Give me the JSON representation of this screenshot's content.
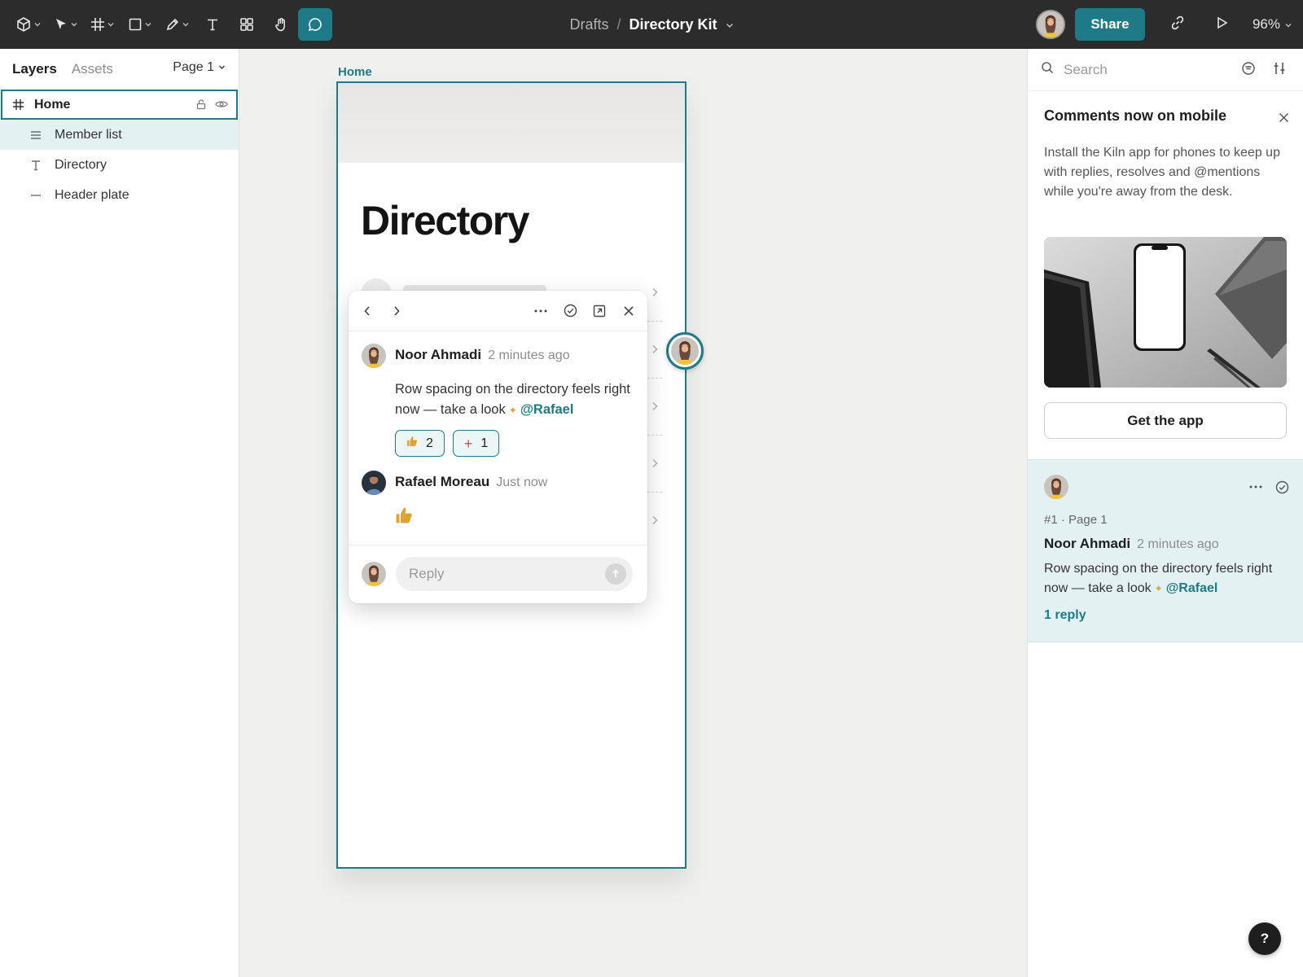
{
  "toolbar": {
    "tools": [
      "main-menu-icon",
      "move-tool-icon",
      "frame-tool-icon",
      "shape-tool-icon",
      "pen-tool-icon",
      "text-tool-icon",
      "components-icon",
      "hand-tool-icon",
      "comment-tool-icon"
    ],
    "active_tool": "comment-tool-icon",
    "breadcrumb_parent": "Drafts",
    "breadcrumb_separator": "/",
    "file_name": "Directory Kit",
    "share_label": "Share",
    "zoom": "96%",
    "accent": "#1f7a87"
  },
  "left_panel": {
    "tab_layers": "Layers",
    "tab_assets": "Assets",
    "page_selector": "Page 1",
    "layers": [
      {
        "name": "Home",
        "icon": "frame-icon",
        "selected": true
      },
      {
        "name": "Member list",
        "icon": "list-icon",
        "highlighted": true
      },
      {
        "name": "Directory",
        "icon": "text-icon"
      },
      {
        "name": "Header plate",
        "icon": "line-icon"
      }
    ]
  },
  "canvas": {
    "frame_label": "Home",
    "frame_title": "Directory"
  },
  "comment_popover": {
    "comments": [
      {
        "author": "Noor Ahmadi",
        "time": "2 minutes ago",
        "text": "Row spacing on the directory feels right now — take a look",
        "mention": "@Rafael",
        "reactions": [
          {
            "emoji": "thumbs-up-icon",
            "count": "2"
          },
          {
            "emoji": "plus-icon",
            "count": "1"
          }
        ]
      },
      {
        "author": "Rafael Moreau",
        "time": "Just now",
        "emoji": "thumbs-up-icon"
      }
    ],
    "reply_placeholder": "Reply"
  },
  "right_panel": {
    "search_placeholder": "Search",
    "promo": {
      "title": "Comments now on mobile",
      "body": "Install the Kiln app for phones to keep up with replies, resolves and @mentions while you're away from the desk.",
      "button": "Get the app"
    },
    "thread": {
      "meta": "#1 · Page 1",
      "author": "Noor Ahmadi",
      "time": "2 minutes ago",
      "text": "Row spacing on the directory feels right now — take a look",
      "mention": "@Rafael",
      "replies": "1 reply"
    }
  },
  "help_label": "?"
}
